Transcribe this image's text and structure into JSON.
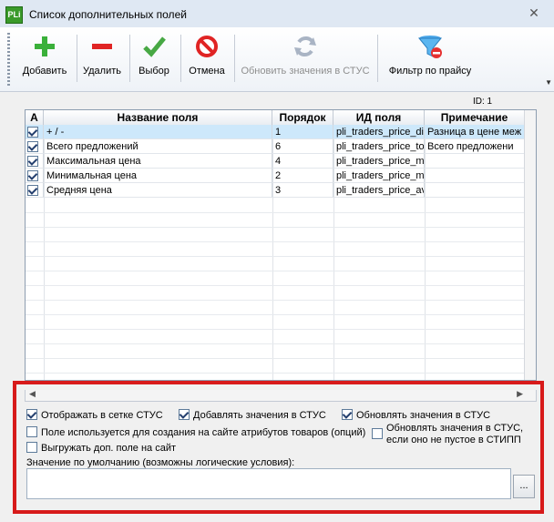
{
  "window": {
    "title": "Список дополнительных полей",
    "icon_text": "PLi"
  },
  "toolbar": {
    "add": "Добавить",
    "delete": "Удалить",
    "select": "Выбор",
    "cancel": "Отмена",
    "update": "Обновить значения в СТУС",
    "filter": "Фильтр по прайсу"
  },
  "id_label": "ID: 1",
  "grid": {
    "headers": {
      "a": "А",
      "name": "Название поля",
      "order": "Порядок",
      "id": "ИД поля",
      "note": "Примечание"
    },
    "rows": [
      {
        "checked": true,
        "name": "+ / -",
        "order": "1",
        "id": "pli_traders_price_dif",
        "note": "Разница в цене меж"
      },
      {
        "checked": true,
        "name": "Всего предложений",
        "order": "6",
        "id": "pli_traders_price_tot",
        "note": "Всего предложени"
      },
      {
        "checked": true,
        "name": "Максимальная цена",
        "order": "4",
        "id": "pli_traders_price_ma",
        "note": ""
      },
      {
        "checked": true,
        "name": "Минимальная цена",
        "order": "2",
        "id": "pli_traders_price_mir",
        "note": ""
      },
      {
        "checked": true,
        "name": "Средняя цена",
        "order": "3",
        "id": "pli_traders_price_av",
        "note": ""
      }
    ]
  },
  "options": {
    "show_in_grid": "Отображать в сетке СТУС",
    "add_values": "Добавлять значения в СТУС",
    "update_values": "Обновлять значения в СТУС",
    "used_for_attrs": "Поле используется для создания на сайте атрибутов товаров (опций)",
    "update_if_not_empty_1": "Обновлять значения в СТУС,",
    "update_if_not_empty_2": "если оно не пустое в СТИПП",
    "export_field": "Выгружать доп. поле на сайт",
    "default_value_label": "Значение по умолчанию (возможны логические условия):",
    "default_value": "",
    "browse": "..."
  },
  "colors": {
    "highlight": "#d71a1a",
    "selection": "#cde8fb"
  }
}
